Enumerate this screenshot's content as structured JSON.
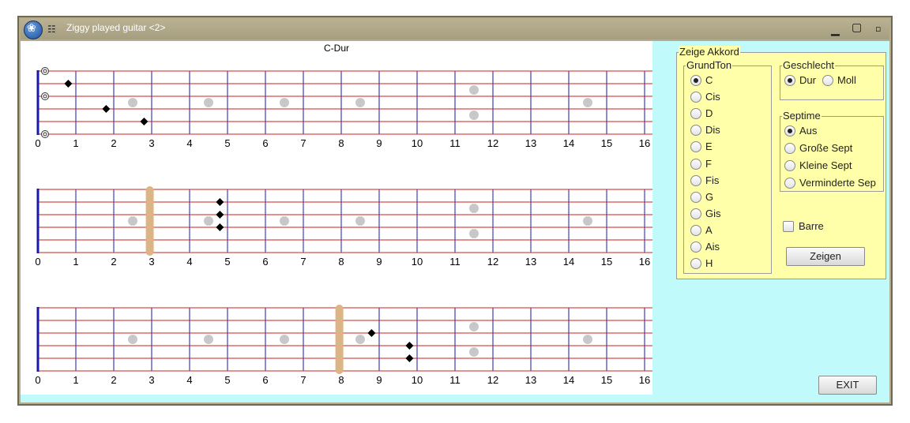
{
  "window": {
    "title": "Ziggy played guitar <2>"
  },
  "chord_title": "C-Dur",
  "fret_numbers": [
    "0",
    "1",
    "2",
    "3",
    "4",
    "5",
    "6",
    "7",
    "8",
    "9",
    "10",
    "11",
    "12",
    "13",
    "14",
    "15",
    "16"
  ],
  "diagrams": [
    {
      "name": "diagram-1",
      "barre_fret": null,
      "open_strings": [
        1,
        3,
        6
      ],
      "notes": [
        {
          "string": 2,
          "fret": 1
        },
        {
          "string": 4,
          "fret": 2
        },
        {
          "string": 5,
          "fret": 3
        }
      ]
    },
    {
      "name": "diagram-2",
      "barre_fret": 3,
      "open_strings": [],
      "notes": [
        {
          "string": 2,
          "fret": 5
        },
        {
          "string": 3,
          "fret": 5
        },
        {
          "string": 4,
          "fret": 5
        }
      ]
    },
    {
      "name": "diagram-3",
      "barre_fret": 8,
      "open_strings": [],
      "notes": [
        {
          "string": 3,
          "fret": 9
        },
        {
          "string": 4,
          "fret": 10
        },
        {
          "string": 5,
          "fret": 10
        }
      ]
    }
  ],
  "panel": {
    "legend": "Zeige Akkord",
    "grundton": {
      "legend": "GrundTon",
      "options": [
        "C",
        "Cis",
        "D",
        "Dis",
        "E",
        "F",
        "Fis",
        "G",
        "Gis",
        "A",
        "Ais",
        "H"
      ],
      "selected": "C"
    },
    "geschlecht": {
      "legend": "Geschlecht",
      "options": [
        "Dur",
        "Moll"
      ],
      "selected": "Dur"
    },
    "septime": {
      "legend": "Septime",
      "options": [
        "Aus",
        "Große Sept",
        "Kleine Sept",
        "Verminderte Sep"
      ],
      "selected": "Aus"
    },
    "barre_label": "Barre",
    "barre_checked": false,
    "show_button": "Zeigen"
  },
  "exit_button": "EXIT",
  "colors": {
    "string": "#cc2222",
    "fret": "#1a1aaa",
    "nut": "#1a1aaa",
    "barre": "#dcb485",
    "marker": "#c8c8c8",
    "note": "#000000",
    "panel": "#ffffaa",
    "bg": "#c0fafa"
  }
}
